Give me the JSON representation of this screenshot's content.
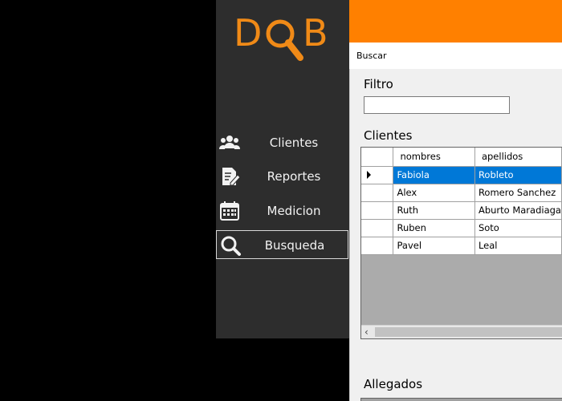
{
  "logo": {
    "letter1": "D",
    "letter2": "B"
  },
  "nav": [
    {
      "label": "Clientes",
      "icon": "users-icon"
    },
    {
      "label": "Reportes",
      "icon": "report-edit-icon"
    },
    {
      "label": "Medicion",
      "icon": "calendar-icon"
    },
    {
      "label": "Busqueda",
      "icon": "search-icon",
      "active": true
    }
  ],
  "window": {
    "title": "Buscar"
  },
  "filtro": {
    "label": "Filtro",
    "value": ""
  },
  "clientes": {
    "label": "Clientes",
    "columns": [
      "nombres",
      "apellidos"
    ],
    "rows": [
      [
        "Fabiola",
        "Robleto"
      ],
      [
        "Alex",
        "Romero Sanchez"
      ],
      [
        "Ruth",
        "Aburto Maradiaga"
      ],
      [
        "Ruben",
        "Soto"
      ],
      [
        "Pavel",
        "Leal"
      ]
    ],
    "selected_row": 0
  },
  "allegados": {
    "label": "Allegados"
  },
  "colors": {
    "accent": "#ff8000",
    "sidebar": "#2d2d2d",
    "selection": "#0078d7"
  }
}
